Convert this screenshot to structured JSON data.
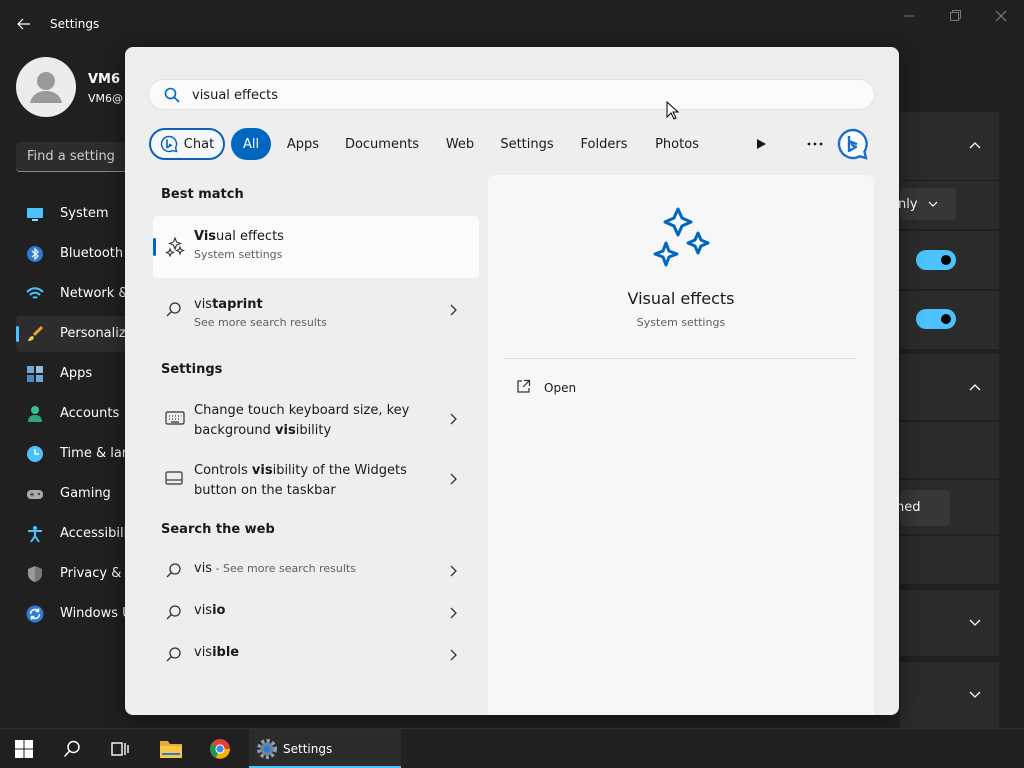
{
  "window": {
    "title": "Settings"
  },
  "user": {
    "name": "VM6",
    "email": "VM6@"
  },
  "find": {
    "placeholder": "Find a setting"
  },
  "nav": [
    {
      "label": "System",
      "icon": "monitor-icon"
    },
    {
      "label": "Bluetooth",
      "icon": "bluetooth-icon"
    },
    {
      "label": "Network &",
      "icon": "wifi-icon"
    },
    {
      "label": "Personaliza",
      "icon": "paintbrush-icon",
      "selected": true
    },
    {
      "label": "Apps",
      "icon": "apps-icon"
    },
    {
      "label": "Accounts",
      "icon": "person-icon"
    },
    {
      "label": "Time & lar",
      "icon": "clock-icon"
    },
    {
      "label": "Gaming",
      "icon": "gamepad-icon"
    },
    {
      "label": "Accessibilit",
      "icon": "accessibility-icon"
    },
    {
      "label": "Privacy & s",
      "icon": "shield-icon"
    },
    {
      "label": "Windows U",
      "icon": "update-icon"
    }
  ],
  "background_panel": {
    "dropdown_text": "nly",
    "button_text": "hed"
  },
  "search": {
    "query": "visual effects"
  },
  "filters": [
    "Chat",
    "All",
    "Apps",
    "Documents",
    "Web",
    "Settings",
    "Folders",
    "Photos"
  ],
  "best_match": {
    "heading": "Best match",
    "title_bold": "Vis",
    "title_rest": "ual effects",
    "subtitle": "System settings"
  },
  "web_suggestion": {
    "bold_prefix": "vis",
    "rest": "taprint",
    "subtitle": "See more search results"
  },
  "settings_section": {
    "heading": "Settings",
    "items": [
      {
        "line1": "Change touch keyboard size, key",
        "line2_pre": "background ",
        "line2_bold": "vis",
        "line2_post": "ibility"
      },
      {
        "line1_pre": "Controls ",
        "line1_bold": "vis",
        "line1_post": "ibility of the Widgets",
        "line2": "button on the taskbar"
      }
    ]
  },
  "web_section": {
    "heading": "Search the web",
    "items": [
      {
        "bold": "vis",
        "rest": "",
        "suffix": " - See more search results"
      },
      {
        "bold": "vis",
        "rest": "io",
        "suffix": ""
      },
      {
        "bold": "vis",
        "rest": "ible",
        "suffix": ""
      }
    ]
  },
  "detail": {
    "title": "Visual effects",
    "subtitle": "System settings",
    "action": "Open"
  },
  "taskbar": {
    "settings_label": "Settings"
  },
  "colors": {
    "accent": "#0067c0",
    "accent_dark_theme": "#4cc2ff"
  }
}
